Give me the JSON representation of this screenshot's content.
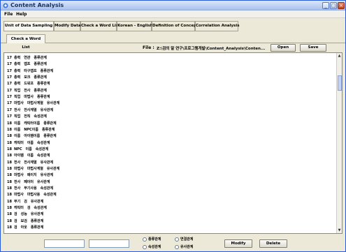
{
  "window": {
    "title": "Content Analysis",
    "minimize": "_",
    "maximize": "□",
    "close": "×"
  },
  "menu": [
    "File",
    "Help"
  ],
  "tabs": [
    "Unit of Data Sampling",
    "Modify Data",
    "Check a Word List",
    "Korean - English",
    "Definition of Concept",
    "Correlation Analysis"
  ],
  "subtab": "Check a Word List",
  "file": {
    "label": "File :",
    "path": "Z:\\검의 말 연구\\프로그램개발\\Content_Analysis\\Conten...",
    "open": "Open",
    "save": "Save"
  },
  "rows": [
    [
      "17",
      "총력",
      "연관",
      "종류관계"
    ],
    [
      "17",
      "총력",
      "맵프",
      "종류관계"
    ],
    [
      "17",
      "총력",
      "타구맵프",
      "종류관계"
    ],
    [
      "17",
      "총력",
      "모크",
      "종류관계"
    ],
    [
      "17",
      "총력",
      "드워프",
      "종류관계"
    ],
    [
      "17",
      "직업",
      "전사",
      "종류관계"
    ],
    [
      "17",
      "직업",
      "마법사",
      "종류관계"
    ],
    [
      "17",
      "마법사",
      "마법사계열",
      "유사관계"
    ],
    [
      "17",
      "전사",
      "전사계열",
      "유사관계"
    ],
    [
      "17",
      "직업",
      "전직",
      "속성관계"
    ],
    [
      "18",
      "이름",
      "캐릭터이름",
      "종류관계"
    ],
    [
      "18",
      "이름",
      "NPC이름",
      "종류관계"
    ],
    [
      "18",
      "이름",
      "아이템이름",
      "종류관계"
    ],
    [
      "18",
      "캐릭터",
      "이름",
      "속성관계"
    ],
    [
      "18",
      "NPC",
      "이름",
      "속성관계"
    ],
    [
      "18",
      "아이템",
      "이름",
      "속성관계"
    ],
    [
      "18",
      "전사",
      "전사계열",
      "유사관계"
    ],
    [
      "18",
      "마법사",
      "마법사계열",
      "유사관계"
    ],
    [
      "18",
      "마법사",
      "메이지",
      "유사관계"
    ],
    [
      "18",
      "전사",
      "페이터",
      "유사관계"
    ],
    [
      "18",
      "전사",
      "무기사용",
      "속성관계"
    ],
    [
      "18",
      "마법사",
      "마법사용",
      "속성관계"
    ],
    [
      "18",
      "무기",
      "검",
      "유사관계"
    ],
    [
      "18",
      "캐릭터",
      "검",
      "속성관계"
    ],
    [
      "18",
      "검",
      "성능",
      "유사관계"
    ],
    [
      "18",
      "검",
      "보검",
      "종류관계"
    ],
    [
      "18",
      "검",
      "아웃",
      "종류관계"
    ]
  ],
  "bottom": {
    "radio1": "종류관계",
    "radio2": "연결관계",
    "radio3": "속성관계",
    "radio4": "유사관계",
    "modify": "Modify",
    "delete": "Delete"
  },
  "scroll": {
    "up": "▲",
    "down": "▼"
  }
}
